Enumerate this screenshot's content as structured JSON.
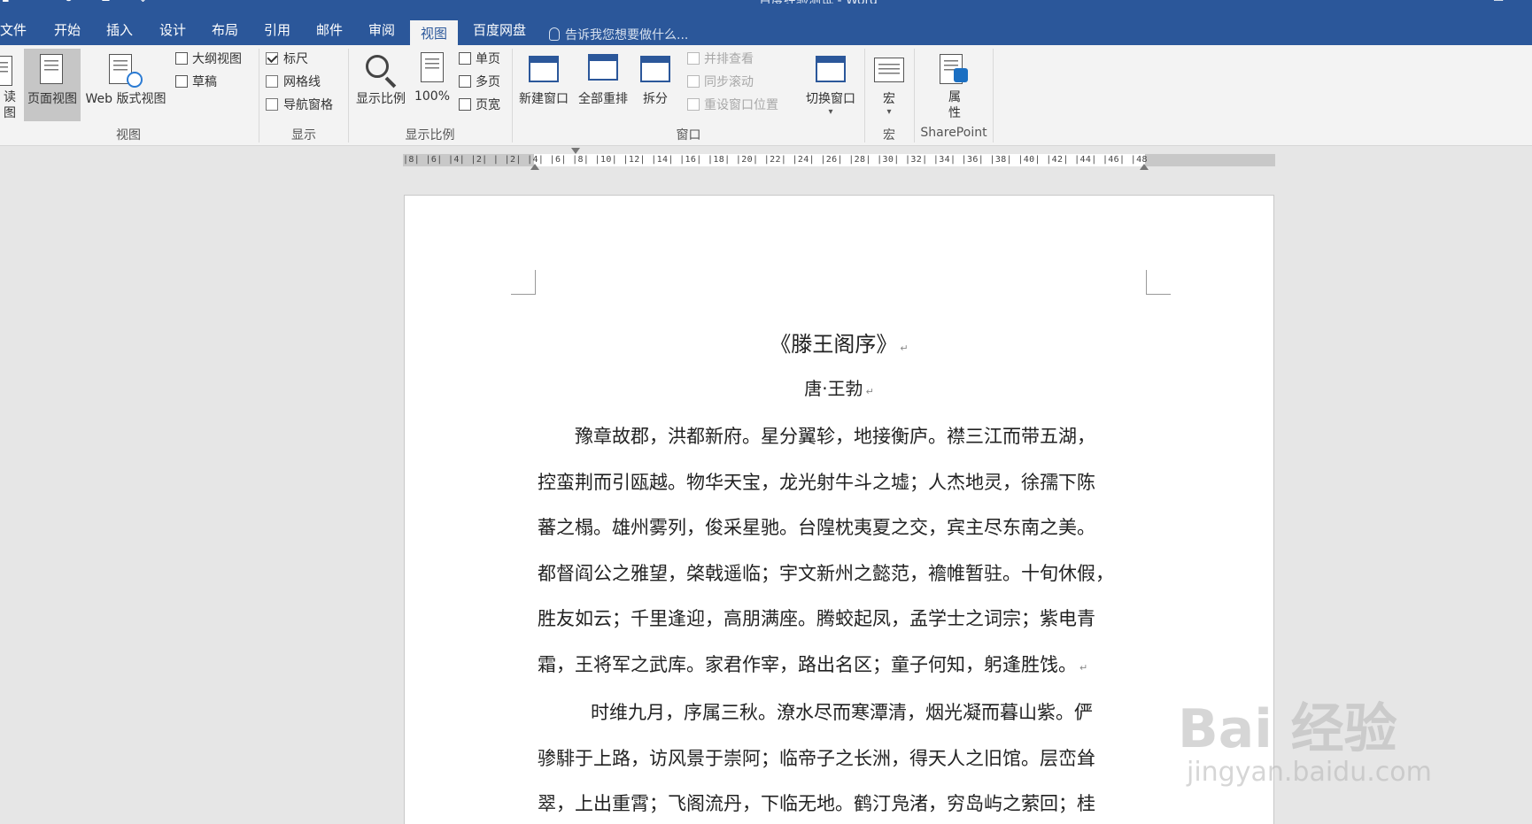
{
  "window": {
    "title": "百度经验测试 - Word"
  },
  "tabs": [
    {
      "label": "文件"
    },
    {
      "label": "开始"
    },
    {
      "label": "插入"
    },
    {
      "label": "设计"
    },
    {
      "label": "布局"
    },
    {
      "label": "引用"
    },
    {
      "label": "邮件"
    },
    {
      "label": "审阅"
    },
    {
      "label": "视图"
    },
    {
      "label": "百度网盘"
    }
  ],
  "tell_me": "告诉我您想要做什么...",
  "ribbon": {
    "views": {
      "read_mode": "读\n图",
      "print_layout": "页面视图",
      "web_layout": "Web 版式视图",
      "outline": "大纲视图",
      "draft": "草稿",
      "group": "视图"
    },
    "show": {
      "ruler": "标尺",
      "gridlines": "网格线",
      "nav_pane": "导航窗格",
      "group": "显示"
    },
    "zoom": {
      "zoom": "显示比例",
      "hundred": "100%",
      "one_page": "单页",
      "multi_page": "多页",
      "page_width": "页宽",
      "group": "显示比例"
    },
    "window": {
      "new_window": "新建窗口",
      "arrange_all": "全部重排",
      "split": "拆分",
      "side_by_side": "并排查看",
      "sync_scroll": "同步滚动",
      "reset_position": "重设窗口位置",
      "switch_windows": "切换窗口",
      "group": "窗口"
    },
    "macros": {
      "macros": "宏",
      "group": "宏"
    },
    "sharepoint": {
      "properties": "属\n性",
      "group": "SharePoint"
    }
  },
  "ruler": {
    "text": "|8|  |6|  |4|  |2|   |  |2|  |4|  |6|  |8|  |10|  |12|  |14|  |16|  |18|  |20|  |22|  |24|  |26|  |28|  |30|  |32|  |34|  |36|  |38|  |40|  |42|  |44|  |46|  |48"
  },
  "document": {
    "title": "《滕王阁序》",
    "author": "唐·王勃",
    "paragraphs": [
      [
        "豫章故郡，洪都新府。星分翼轸，地接衡庐。襟三江而带五湖，",
        "控蛮荆而引瓯越。物华天宝，龙光射牛斗之墟；人杰地灵，徐孺下陈",
        "蕃之榻。雄州雾列，俊采星驰。台隍枕夷夏之交，宾主尽东南之美。",
        "都督阎公之雅望，棨戟遥临；宇文新州之懿范，襜帷暂驻。十旬休假，",
        "胜友如云；千里逢迎，高朋满座。腾蛟起凤，孟学士之词宗；紫电青",
        "霜，王将军之武库。家君作宰，路出名区；童子何知，躬逢胜饯。"
      ],
      [
        "时维九月，序属三秋。潦水尽而寒潭清，烟光凝而暮山紫。俨",
        "骖騑于上路，访风景于崇阿；临帝子之长洲，得天人之旧馆。层峦耸",
        "翠，上出重霄；飞阁流丹，下临无地。鹤汀凫渚，穷岛屿之萦回；桂"
      ]
    ]
  },
  "watermark": {
    "brand": "Bai 经验",
    "url": "jingyan.baidu.com"
  }
}
